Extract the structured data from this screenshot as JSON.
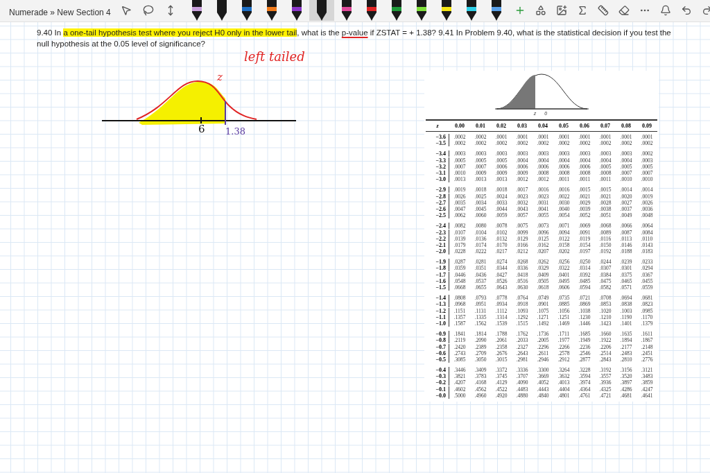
{
  "breadcrumb": "Numerade » New Section 4",
  "pens": [
    {
      "color": "#c9a0dc",
      "selected": false
    },
    {
      "color": "#1a1a1a",
      "selected": false
    },
    {
      "color": "#1e6fc4",
      "selected": false
    },
    {
      "color": "#f07a1a",
      "selected": false
    },
    {
      "color": "#8b35c9",
      "selected": false
    },
    {
      "color": "#1a1a1a",
      "selected": true
    },
    {
      "color": "#e0489a",
      "selected": false
    },
    {
      "color": "#e02424",
      "selected": false
    },
    {
      "color": "#1f9a3a",
      "selected": false
    },
    {
      "color": "#7ee03a",
      "selected": false
    },
    {
      "color": "#f5e614",
      "selected": false
    },
    {
      "color": "#2ed0e8",
      "selected": false
    },
    {
      "color": "#5aa0e8",
      "selected": false
    }
  ],
  "question": [
    {
      "kind": "plain",
      "text": "9.40  In "
    },
    {
      "kind": "highlight",
      "text": "a one-tail hypothesis test where you reject H0 only in the lower tail"
    },
    {
      "kind": "plain",
      "text": ", what is the "
    },
    {
      "kind": "underline",
      "text": "p-value"
    },
    {
      "kind": "plain",
      "text": " if ZSTAT = + 1.38? 9.41  In Problem 9.40, what is the statistical decision if you test the null hypothesis at the 0.05 level of significance?"
    }
  ],
  "ink": {
    "note": "left tailed",
    "curve_label": "z",
    "center_label": "6",
    "cut_label": "1.38"
  },
  "curve_figure": {
    "z_label": "z",
    "zero_label": "0"
  },
  "table": {
    "columns": [
      "z",
      "0.00",
      "0.01",
      "0.02",
      "0.03",
      "0.04",
      "0.05",
      "0.06",
      "0.07",
      "0.08",
      "0.09"
    ],
    "groups": [
      [
        [
          "−3.6",
          ".0002",
          ".0002",
          ".0001",
          ".0001",
          ".0001",
          ".0001",
          ".0001",
          ".0001",
          ".0001",
          ".0001"
        ],
        [
          "−3.5",
          ".0002",
          ".0002",
          ".0002",
          ".0002",
          ".0002",
          ".0002",
          ".0002",
          ".0002",
          ".0002",
          ".0002"
        ]
      ],
      [
        [
          "−3.4",
          ".0003",
          ".0003",
          ".0003",
          ".0003",
          ".0003",
          ".0003",
          ".0003",
          ".0003",
          ".0003",
          ".0002"
        ],
        [
          "−3.3",
          ".0005",
          ".0005",
          ".0005",
          ".0004",
          ".0004",
          ".0004",
          ".0004",
          ".0004",
          ".0004",
          ".0003"
        ],
        [
          "−3.2",
          ".0007",
          ".0007",
          ".0006",
          ".0006",
          ".0006",
          ".0006",
          ".0006",
          ".0005",
          ".0005",
          ".0005"
        ],
        [
          "−3.1",
          ".0010",
          ".0009",
          ".0009",
          ".0009",
          ".0008",
          ".0008",
          ".0008",
          ".0008",
          ".0007",
          ".0007"
        ],
        [
          "−3.0",
          ".0013",
          ".0013",
          ".0013",
          ".0012",
          ".0012",
          ".0011",
          ".0011",
          ".0011",
          ".0010",
          ".0010"
        ]
      ],
      [
        [
          "−2.9",
          ".0019",
          ".0018",
          ".0018",
          ".0017",
          ".0016",
          ".0016",
          ".0015",
          ".0015",
          ".0014",
          ".0014"
        ],
        [
          "−2.8",
          ".0026",
          ".0025",
          ".0024",
          ".0023",
          ".0023",
          ".0022",
          ".0021",
          ".0021",
          ".0020",
          ".0019"
        ],
        [
          "−2.7",
          ".0035",
          ".0034",
          ".0033",
          ".0032",
          ".0031",
          ".0030",
          ".0029",
          ".0028",
          ".0027",
          ".0026"
        ],
        [
          "−2.6",
          ".0047",
          ".0045",
          ".0044",
          ".0043",
          ".0041",
          ".0040",
          ".0039",
          ".0038",
          ".0037",
          ".0036"
        ],
        [
          "−2.5",
          ".0062",
          ".0060",
          ".0059",
          ".0057",
          ".0055",
          ".0054",
          ".0052",
          ".0051",
          ".0049",
          ".0048"
        ]
      ],
      [
        [
          "−2.4",
          ".0082",
          ".0080",
          ".0078",
          ".0075",
          ".0073",
          ".0071",
          ".0069",
          ".0068",
          ".0066",
          ".0064"
        ],
        [
          "−2.3",
          ".0107",
          ".0104",
          ".0102",
          ".0099",
          ".0096",
          ".0094",
          ".0091",
          ".0089",
          ".0087",
          ".0084"
        ],
        [
          "−2.2",
          ".0139",
          ".0136",
          ".0132",
          ".0129",
          ".0125",
          ".0122",
          ".0119",
          ".0116",
          ".0113",
          ".0110"
        ],
        [
          "−2.1",
          ".0179",
          ".0174",
          ".0170",
          ".0166",
          ".0162",
          ".0158",
          ".0154",
          ".0150",
          ".0146",
          ".0143"
        ],
        [
          "−2.0",
          ".0228",
          ".0222",
          ".0217",
          ".0212",
          ".0207",
          ".0202",
          ".0197",
          ".0192",
          ".0188",
          ".0183"
        ]
      ],
      [
        [
          "−1.9",
          ".0287",
          ".0281",
          ".0274",
          ".0268",
          ".0262",
          ".0256",
          ".0250",
          ".0244",
          ".0239",
          ".0233"
        ],
        [
          "−1.8",
          ".0359",
          ".0351",
          ".0344",
          ".0336",
          ".0329",
          ".0322",
          ".0314",
          ".0307",
          ".0301",
          ".0294"
        ],
        [
          "−1.7",
          ".0446",
          ".0436",
          ".0427",
          ".0418",
          ".0409",
          ".0401",
          ".0392",
          ".0384",
          ".0375",
          ".0367"
        ],
        [
          "−1.6",
          ".0548",
          ".0537",
          ".0526",
          ".0516",
          ".0505",
          ".0495",
          ".0485",
          ".0475",
          ".0465",
          ".0455"
        ],
        [
          "−1.5",
          ".0668",
          ".0655",
          ".0643",
          ".0630",
          ".0618",
          ".0606",
          ".0594",
          ".0582",
          ".0571",
          ".0559"
        ]
      ],
      [
        [
          "−1.4",
          ".0808",
          ".0793",
          ".0778",
          ".0764",
          ".0749",
          ".0735",
          ".0721",
          ".0708",
          ".0694",
          ".0681"
        ],
        [
          "−1.3",
          ".0968",
          ".0951",
          ".0934",
          ".0918",
          ".0901",
          ".0885",
          ".0869",
          ".0853",
          ".0838",
          ".0823"
        ],
        [
          "−1.2",
          ".1151",
          ".1131",
          ".1112",
          ".1093",
          ".1075",
          ".1056",
          ".1038",
          ".1020",
          ".1003",
          ".0985"
        ],
        [
          "−1.1",
          ".1357",
          ".1335",
          ".1314",
          ".1292",
          ".1271",
          ".1251",
          ".1230",
          ".1210",
          ".1190",
          ".1170"
        ],
        [
          "−1.0",
          ".1587",
          ".1562",
          ".1539",
          ".1515",
          ".1492",
          ".1469",
          ".1446",
          ".1423",
          ".1401",
          ".1379"
        ]
      ],
      [
        [
          "−0.9",
          ".1841",
          ".1814",
          ".1788",
          ".1762",
          ".1736",
          ".1711",
          ".1685",
          ".1660",
          ".1635",
          ".1611"
        ],
        [
          "−0.8",
          ".2119",
          ".2090",
          ".2061",
          ".2033",
          ".2005",
          ".1977",
          ".1949",
          ".1922",
          ".1894",
          ".1867"
        ],
        [
          "−0.7",
          ".2420",
          ".2389",
          ".2358",
          ".2327",
          ".2296",
          ".2266",
          ".2236",
          ".2206",
          ".2177",
          ".2148"
        ],
        [
          "−0.6",
          ".2743",
          ".2709",
          ".2676",
          ".2643",
          ".2611",
          ".2578",
          ".2546",
          ".2514",
          ".2483",
          ".2451"
        ],
        [
          "−0.5",
          ".3085",
          ".3050",
          ".3015",
          ".2981",
          ".2946",
          ".2912",
          ".2877",
          ".2843",
          ".2810",
          ".2776"
        ]
      ],
      [
        [
          "−0.4",
          ".3446",
          ".3409",
          ".3372",
          ".3336",
          ".3300",
          ".3264",
          ".3228",
          ".3192",
          ".3156",
          ".3121"
        ],
        [
          "−0.3",
          ".3821",
          ".3783",
          ".3745",
          ".3707",
          ".3669",
          ".3632",
          ".3594",
          ".3557",
          ".3520",
          ".3483"
        ],
        [
          "−0.2",
          ".4207",
          ".4168",
          ".4129",
          ".4090",
          ".4052",
          ".4013",
          ".3974",
          ".3936",
          ".3897",
          ".3859"
        ],
        [
          "−0.1",
          ".4602",
          ".4562",
          ".4522",
          ".4483",
          ".4443",
          ".4404",
          ".4364",
          ".4325",
          ".4286",
          ".4247"
        ],
        [
          "−0.0",
          ".5000",
          ".4960",
          ".4920",
          ".4880",
          ".4840",
          ".4801",
          ".4761",
          ".4721",
          ".4681",
          ".4641"
        ]
      ]
    ]
  }
}
